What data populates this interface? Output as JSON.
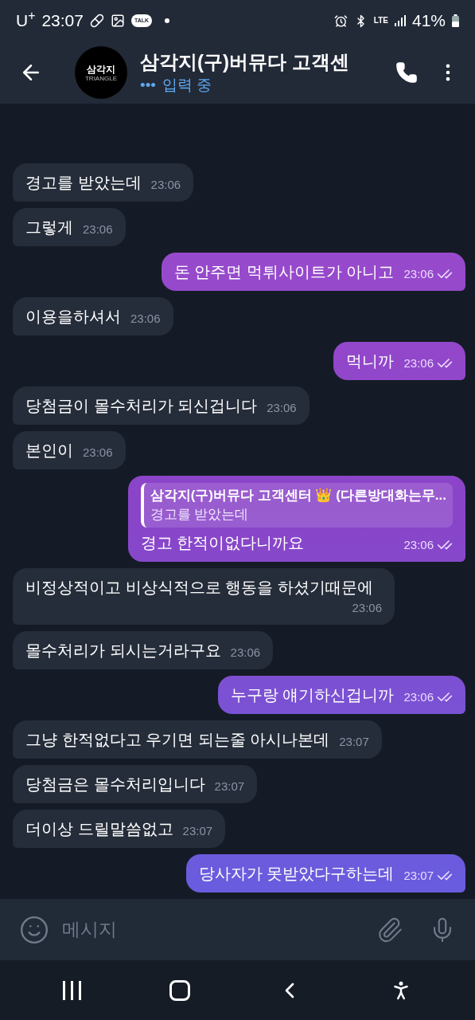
{
  "status_bar": {
    "carrier": "U$^{+}$",
    "time": "23:07",
    "talk_badge": "TALK",
    "network": "LTE",
    "battery": "41%"
  },
  "header": {
    "title": "삼각지(구)버뮤다 고객센",
    "avatar_text": "삼각지",
    "avatar_subtext": "TRIANGLE",
    "status_dots": "•••",
    "status": "입력 중"
  },
  "messages": [
    {
      "kind": "incoming",
      "text": "경고를 받았는데",
      "time": "23:06"
    },
    {
      "kind": "incoming",
      "text": "그렇게",
      "time": "23:06"
    },
    {
      "kind": "outgoing",
      "text": "돈 안주면 먹튀사이트가 아니고",
      "time": "23:06",
      "read": true
    },
    {
      "kind": "incoming",
      "text": "이용을하셔서",
      "time": "23:06"
    },
    {
      "kind": "outgoing",
      "text": "먹니까",
      "time": "23:06",
      "read": true
    },
    {
      "kind": "incoming",
      "text": "당첨금이 몰수처리가 되신겁니다",
      "time": "23:06"
    },
    {
      "kind": "incoming",
      "text": "본인이",
      "time": "23:06"
    },
    {
      "kind": "outgoing",
      "text": "경고 한적이없다니까요",
      "time": "23:06",
      "read": true,
      "reply": {
        "author": "삼각지(구)버뮤다 고객센터 👑 (다른방대화는무...",
        "text": "경고를 받았는데"
      }
    },
    {
      "kind": "incoming",
      "text": "비정상적이고 비상식적으로 행동을 하셨기때문에",
      "time": "23:06"
    },
    {
      "kind": "incoming",
      "text": "몰수처리가 되시는거라구요",
      "time": "23:06"
    },
    {
      "kind": "outgoing",
      "text": "누구랑 얘기하신겁니까",
      "time": "23:06",
      "read": true
    },
    {
      "kind": "incoming",
      "text": "그냥 한적없다고 우기면 되는줄 아시나본데",
      "time": "23:07"
    },
    {
      "kind": "incoming",
      "text": "당첨금은 몰수처리입니다",
      "time": "23:07"
    },
    {
      "kind": "incoming",
      "text": "더이상 드릴말씀없고",
      "time": "23:07"
    },
    {
      "kind": "outgoing",
      "text": "당사자가 못받았다구하는데",
      "time": "23:07",
      "read": true
    }
  ],
  "composer": {
    "placeholder": "메시지"
  }
}
